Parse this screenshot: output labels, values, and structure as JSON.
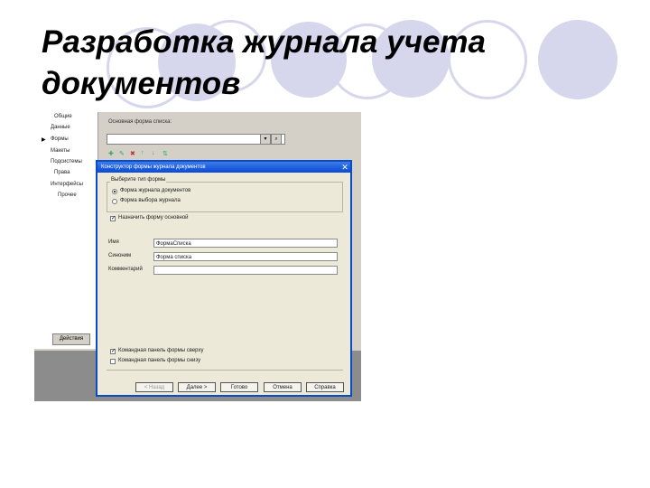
{
  "slide": {
    "title_line1": "Разработка журнала учета",
    "title_line2": "документов"
  },
  "background_window": {
    "left_panel_items": [
      "Общие",
      "Данные",
      "Формы",
      "Макеты",
      "Подсистемы",
      "Права",
      "Интерфейсы",
      "Прочее"
    ],
    "main_form_label": "Основная форма списка:",
    "bottom_button": "Действия",
    "combo_arrow_icon": "chevron-down-icon",
    "combo_search_icon": "search-icon"
  },
  "dialog": {
    "title": "Конструктор формы журнала документов",
    "close_label": "✕",
    "group_label": "Выберите тип формы",
    "radio_options": [
      {
        "label": "Форма журнала документов",
        "selected": true
      },
      {
        "label": "Форма выбора журнала",
        "selected": false
      }
    ],
    "checkbox_main": {
      "label": "Назначить форму основной",
      "checked": true
    },
    "fields": [
      {
        "label": "Имя",
        "value": "ФормаСписка"
      },
      {
        "label": "Синоним",
        "value": "Форма списка"
      },
      {
        "label": "Комментарий",
        "value": ""
      }
    ],
    "checkbox_bottom_1": {
      "label": "Командная панель формы сверху",
      "checked": true
    },
    "checkbox_bottom_2": {
      "label": "Командная панель формы снизу",
      "checked": false
    },
    "buttons": {
      "back": "< Назад",
      "next": "Далее >",
      "finish": "Готово",
      "cancel": "Отмена",
      "help": "Справка"
    }
  },
  "colors": {
    "circle": "#d6d6ec",
    "titlebar": "#0b4ad6",
    "dialog_bg": "#ece9d8"
  }
}
